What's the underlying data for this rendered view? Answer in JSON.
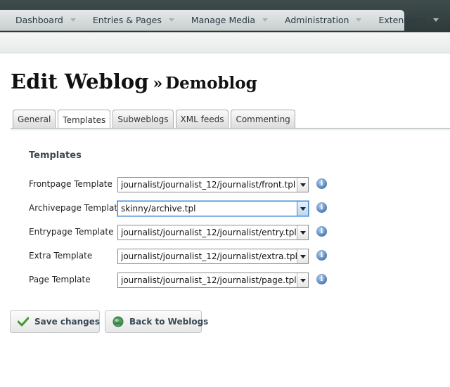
{
  "nav": {
    "items": [
      {
        "label": "Dashboard"
      },
      {
        "label": "Entries & Pages"
      },
      {
        "label": "Manage Media"
      },
      {
        "label": "Administration"
      },
      {
        "label": "Extensions"
      }
    ]
  },
  "header": {
    "title": "Edit Weblog",
    "separator": "»",
    "subtitle": "Demoblog"
  },
  "tabs": [
    {
      "label": "General",
      "active": false
    },
    {
      "label": "Templates",
      "active": true
    },
    {
      "label": "Subweblogs",
      "active": false
    },
    {
      "label": "XML feeds",
      "active": false
    },
    {
      "label": "Commenting",
      "active": false
    }
  ],
  "form": {
    "section_title": "Templates",
    "rows": [
      {
        "label": "Frontpage Template",
        "value": "journalist/journalist_12/journalist/front.tpl"
      },
      {
        "label": "Archivepage Template",
        "value": "skinny/archive.tpl"
      },
      {
        "label": "Entrypage Template",
        "value": "journalist/journalist_12/journalist/entry.tpl"
      },
      {
        "label": "Extra Template",
        "value": "journalist/journalist_12/journalist/extra.tpl"
      },
      {
        "label": "Page Template",
        "value": "journalist/journalist_12/journalist/page.tpl"
      }
    ],
    "info_glyph": "i"
  },
  "buttons": {
    "save_label": "Save changes",
    "back_label": "Back to Weblogs"
  },
  "icons": {
    "info": "info-icon",
    "save": "checkmark-icon",
    "back": "globe-icon"
  },
  "colors": {
    "topbar": "#2e3a3a",
    "nav_strip": "#d4d9d9",
    "section_text": "#3a4a55",
    "checkmark": "#3f9a2e",
    "info": "#4c7bb6",
    "focus": "#4a86c8"
  }
}
